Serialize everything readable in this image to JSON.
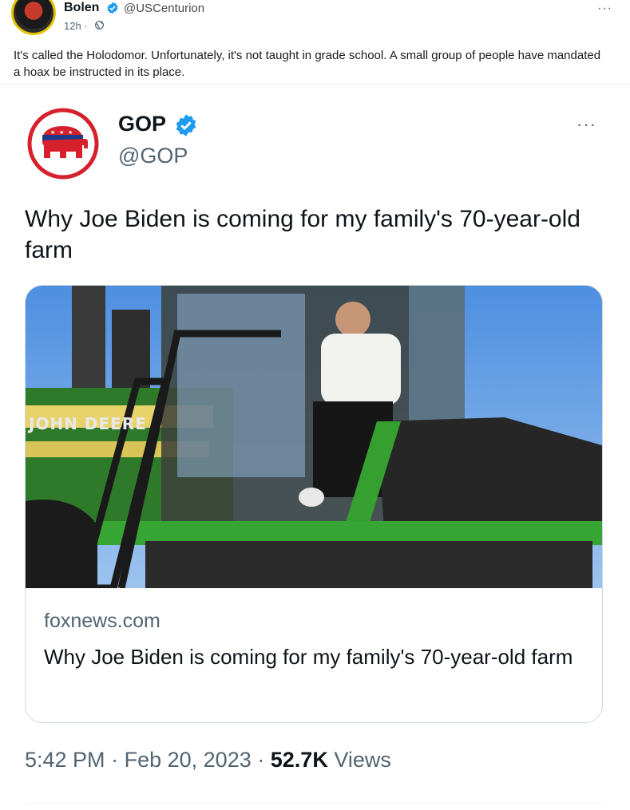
{
  "post": {
    "author_name": "Bolen",
    "author_handle": "@USCenturion",
    "time": "12h ·",
    "menu": "···",
    "text": "It's called the Holodomor. Unfortunately, it's not taught in grade school. A small group of people have mandated a hoax be instructed in its place."
  },
  "embedded_tweet": {
    "name": "GOP",
    "handle": "@GOP",
    "menu": "···",
    "text": "Why Joe Biden is coming for my family's 70-year-old farm",
    "card": {
      "domain": "foxnews.com",
      "title": "Why Joe Biden is coming for my family's 70-year-old farm",
      "image_lettering": "JOHN DEERE"
    },
    "time": "5:42 PM",
    "date": "Feb 20, 2023",
    "separator": "·",
    "views_count": "52.7K",
    "views_label": "Views"
  },
  "colors": {
    "verified": "#1d9bf0",
    "gop_red": "#d6202b",
    "tractor_green": "#2f7a2a",
    "muted_text": "#536471"
  },
  "icons": [
    "verified-badge-icon",
    "globe-icon",
    "gop-elephant-logo",
    "more-icon"
  ]
}
